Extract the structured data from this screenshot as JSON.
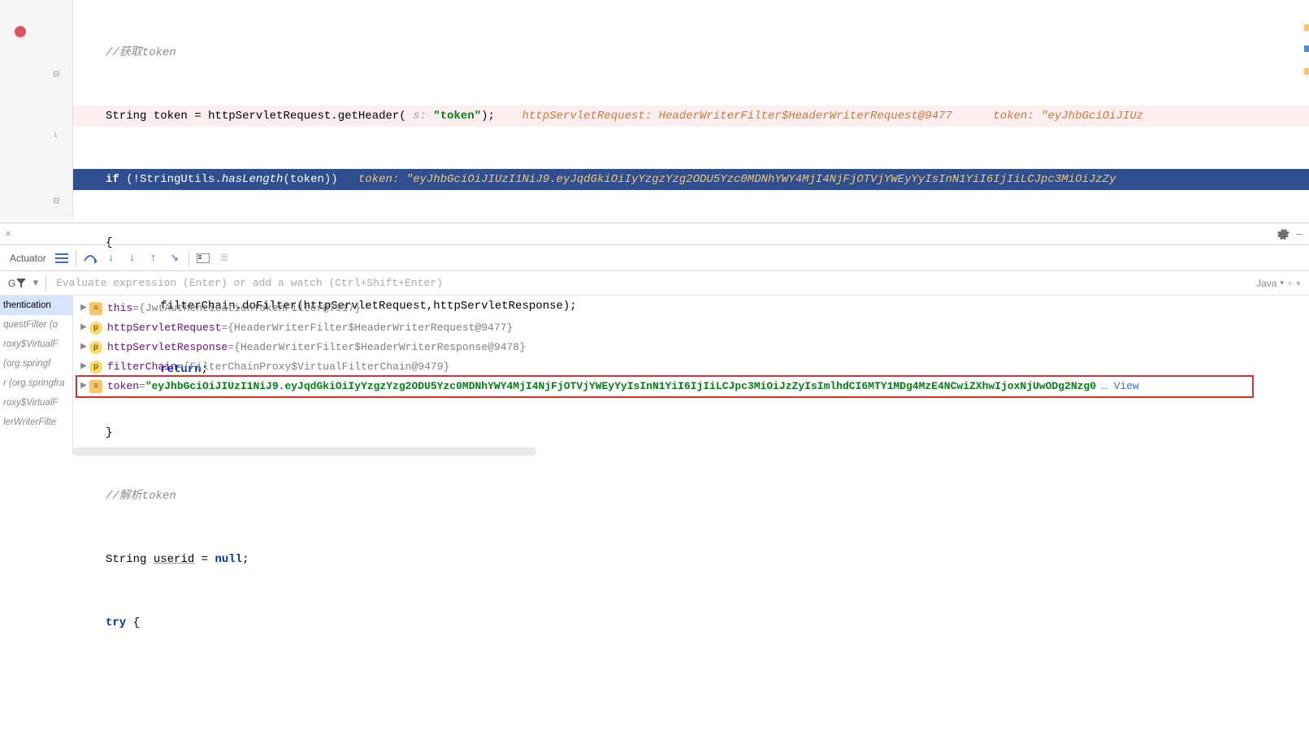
{
  "code": {
    "comment1": "//获取token",
    "line1": {
      "type": "String",
      "var": "token",
      "call": "httpServletRequest.getHeader(",
      "param_hint": " s: ",
      "param_val": "\"token\"",
      "close": ");",
      "hint1_name": "httpServletRequest:",
      "hint1_val": " HeaderWriterFilter$HeaderWriterRequest@9477",
      "hint2_name": "token:",
      "hint2_val": " \"eyJhbGciOiJIUz"
    },
    "line2": {
      "kw": "if",
      "expr_pre": " (!StringUtils.",
      "method": "hasLength",
      "expr_post": "(token))",
      "hint_name": "token:",
      "hint_val": " \"eyJhbGciOiJIUzI1NiJ9.eyJqdGkiOiIyYzgzYzg2ODU5Yzc0MDNhYWY4MjI4NjFjOTVjYWEyYyIsInN1YiI6IjIiLCJpc3MiOiJzZy"
    },
    "line3_open": "{",
    "line4": "        filterChain.doFilter(httpServletRequest,httpServletResponse);",
    "line5_kw": "return",
    "line5_post": ";",
    "line6_close": "}",
    "comment2": "//解析token",
    "line8_type": "String",
    "line8_var": "userid",
    "line8_rest": " = ",
    "line8_null": "null",
    "line8_end": ";",
    "line9_kw": "try",
    "line9_post": " {"
  },
  "debug": {
    "actuator_label": "Actuator",
    "g_label": "G",
    "expr_placeholder": "Evaluate expression (Enter) or add a watch (Ctrl+Shift+Enter)",
    "lang": "Java",
    "frames": [
      "thentication",
      "questFilter (o",
      "roxy$VirtualF",
      " (org.springf",
      "r (org.springfra",
      "roxy$VirtualF",
      "lerWriterFilte"
    ],
    "vars": [
      {
        "icon": "obj",
        "name": "this",
        "eq": " = ",
        "value": "{JwtAuthenticationTokenFilter@7917}"
      },
      {
        "icon": "p",
        "name": "httpServletRequest",
        "eq": " = ",
        "value": "{HeaderWriterFilter$HeaderWriterRequest@9477}"
      },
      {
        "icon": "p",
        "name": "httpServletResponse",
        "eq": " = ",
        "value": "{HeaderWriterFilter$HeaderWriterResponse@9478}"
      },
      {
        "icon": "p",
        "name": "filterChain",
        "eq": " = ",
        "value": "{FilterChainProxy$VirtualFilterChain@9479}"
      },
      {
        "icon": "obj",
        "name": "token",
        "eq": " = ",
        "str": "\"eyJhbGciOiJIUzI1NiJ9.eyJqdGkiOiIyYzgzYzg2ODU5Yzc0MDNhYWY4MjI4NjFjOTVjYWEyYyIsInN1YiI6IjIiLCJpc3MiOiJzZyIsImlhdCI6MTY1MDg4MzE4NCwiZXhwIjoxNjUwODg2Nzg0"
      }
    ],
    "view_link": "… View"
  }
}
